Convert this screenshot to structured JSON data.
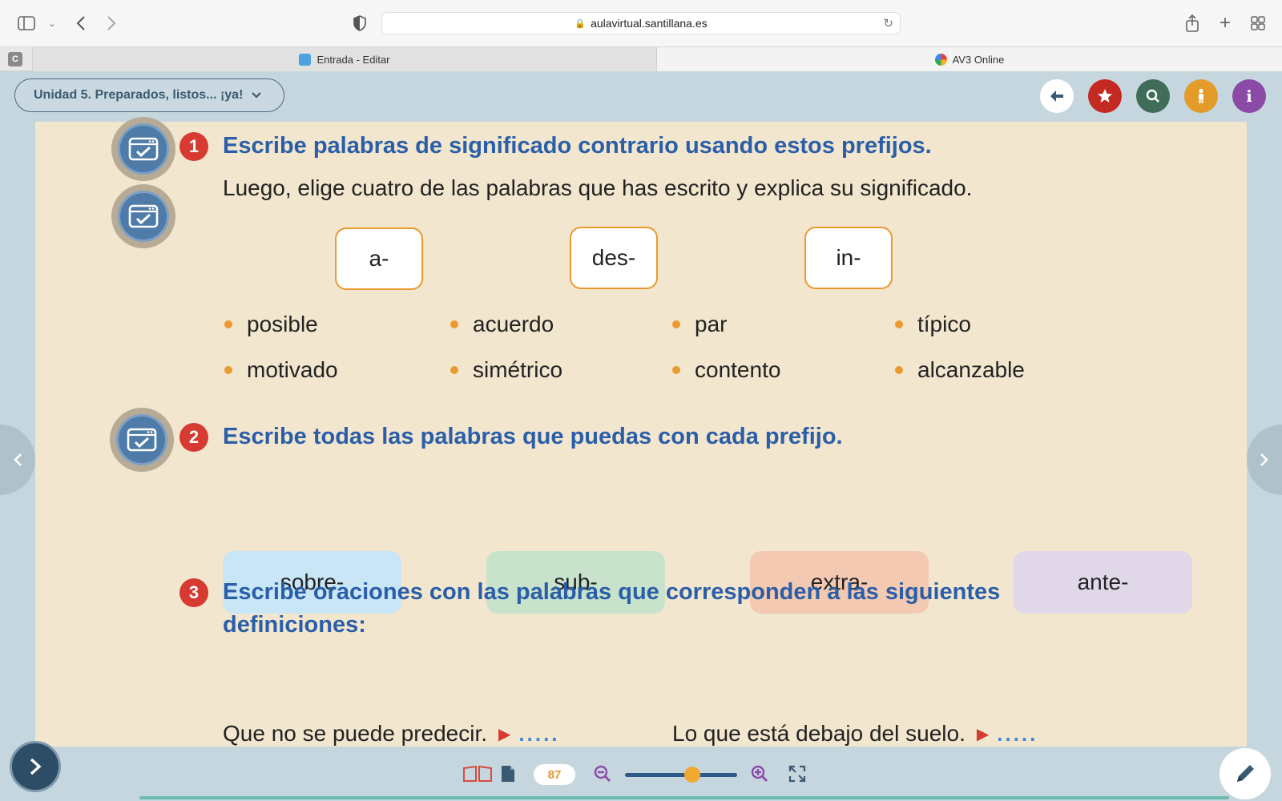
{
  "browser": {
    "url": "aulavirtual.santillana.es",
    "tabs": [
      {
        "label": "Entrada - Editar",
        "favicon_color": "#4aa3df"
      },
      {
        "label": "AV3 Online",
        "favicon_color": "#f2b230"
      }
    ],
    "pinned_tab_letter": "C"
  },
  "app": {
    "unit_title": "Unidad 5. Preparados, listos... ¡ya!",
    "top_buttons": [
      {
        "name": "back-button",
        "icon": "arrow-left",
        "color": "#ffffff"
      },
      {
        "name": "favorites-button",
        "icon": "star",
        "color": "#c42a22"
      },
      {
        "name": "search-button",
        "icon": "magnifier",
        "color": "#3f6d5a"
      },
      {
        "name": "accessibility-button",
        "icon": "person",
        "color": "#e39b2a"
      },
      {
        "name": "info-button",
        "icon": "info",
        "color": "#8a4aa6"
      }
    ]
  },
  "exercise1": {
    "number": "1",
    "title": "Escribe palabras de significado contrario usando estos prefijos.",
    "instruction": "Luego, elige cuatro de las palabras que has escrito y explica su significado.",
    "prefixes": [
      "a-",
      "des-",
      "in-"
    ],
    "words": [
      "posible",
      "acuerdo",
      "par",
      "típico",
      "motivado",
      "simétrico",
      "contento",
      "alcanzable"
    ]
  },
  "exercise2": {
    "number": "2",
    "title": "Escribe todas las palabras que puedas con cada prefijo.",
    "prefixes": [
      {
        "label": "sobre-",
        "color": "#c9e6f7"
      },
      {
        "label": "sub-",
        "color": "#c8e2cc"
      },
      {
        "label": "extra-",
        "color": "#f4c9b2"
      },
      {
        "label": "ante-",
        "color": "#e0d7e8"
      }
    ]
  },
  "exercise3": {
    "number": "3",
    "title_line1": "Escribe oraciones con las palabras que corresponden a las siguientes",
    "title_line2": "definiciones:",
    "definitions": [
      "Que no se puede predecir.",
      "Lo que está debajo del suelo."
    ],
    "blank": "....."
  },
  "footer": {
    "page_number": "87",
    "zoom_level": 0.6
  }
}
